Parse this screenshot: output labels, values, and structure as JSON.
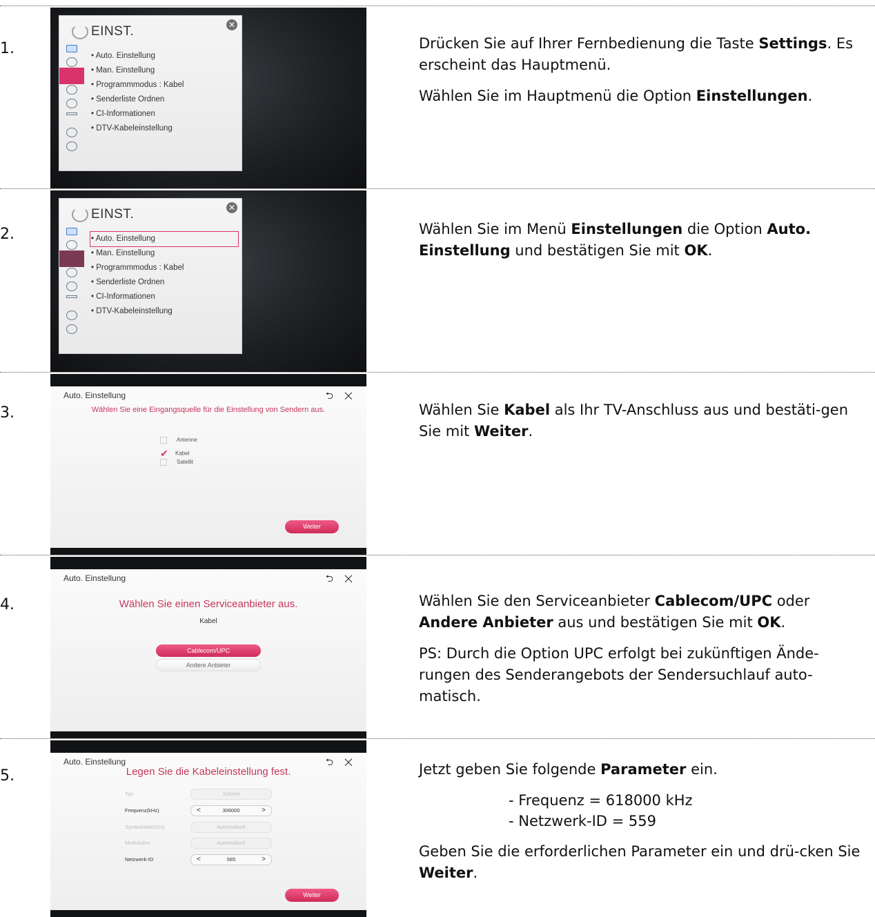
{
  "steps": [
    {
      "number": "1.",
      "paragraphs": [
        [
          [
            "Drücken Sie auf Ihrer Fernbedienung die Taste ",
            false
          ],
          [
            "Settings",
            true
          ],
          [
            ". Es erscheint das Hauptmenü.",
            false
          ]
        ],
        [
          [
            "Wählen Sie im Hauptmenü die Option ",
            false
          ],
          [
            "Einstellungen",
            true
          ],
          [
            ".",
            false
          ]
        ]
      ]
    },
    {
      "number": "2.",
      "paragraphs": [
        [
          [
            "Wählen Sie im Menü ",
            false
          ],
          [
            "Einstellungen",
            true
          ],
          [
            " die Option ",
            false
          ],
          [
            "Auto. Einstellung",
            true
          ],
          [
            " und bestätigen Sie mit ",
            false
          ],
          [
            "OK",
            true
          ],
          [
            ".",
            false
          ]
        ]
      ]
    },
    {
      "number": "3.",
      "paragraphs": [
        [
          [
            "Wählen Sie ",
            false
          ],
          [
            "Kabel",
            true
          ],
          [
            " als Ihr TV-Anschluss aus und bestäti-gen Sie mit ",
            false
          ],
          [
            "Weiter",
            true
          ],
          [
            ".",
            false
          ]
        ]
      ]
    },
    {
      "number": "4.",
      "paragraphs": [
        [
          [
            "Wählen Sie den Serviceanbieter ",
            false
          ],
          [
            "Cablecom/UPC",
            true
          ],
          [
            " oder ",
            false
          ],
          [
            "Andere Anbieter",
            true
          ],
          [
            " aus und bestätigen Sie mit ",
            false
          ],
          [
            "OK",
            true
          ],
          [
            ".",
            false
          ]
        ],
        [
          [
            "PS: Durch die Option UPC erfolgt bei zukünftigen Ände-rungen des Senderangebots der Sendersuchlauf auto-matisch.",
            false
          ]
        ]
      ]
    },
    {
      "number": "5.",
      "intro": [
        [
          "Jetzt geben Sie folgende ",
          false
        ],
        [
          "Parameter",
          true
        ],
        [
          " ein.",
          false
        ]
      ],
      "params": [
        "- Frequenz = 618000 kHz",
        "- Netzwerk-ID = 559"
      ],
      "outro": [
        [
          "Geben Sie die erforderlichen Parameter ein und drü-cken Sie ",
          false
        ],
        [
          "Weiter",
          true
        ],
        [
          ".",
          false
        ]
      ]
    }
  ],
  "menu": {
    "title": "EINST.",
    "close_icon": "close-icon",
    "items": [
      "• Auto. Einstellung",
      "• Man. Einstellung",
      "• Programmmodus      : Kabel",
      "• Senderliste Ordnen",
      "• CI-Informationen",
      "• DTV-Kabeleinstellung"
    ]
  },
  "dialog": {
    "title": "Auto. Einstellung",
    "controls": "⮌ ✕",
    "step3": {
      "subtitle": "Wählen Sie eine Eingangsquelle für die Einstellung von Sendern aus.",
      "options": [
        {
          "label": "Antenne",
          "checked": false
        },
        {
          "label": "Kabel",
          "checked": true
        },
        {
          "label": "Satellit",
          "checked": false
        }
      ],
      "next": "Weiter"
    },
    "step4": {
      "subtitle": "Wählen Sie einen Serviceanbieter aus.",
      "source": "Kabel",
      "option_selected": "Cablecom/UPC",
      "option_other": "Andere Anbieter"
    },
    "step5": {
      "subtitle": "Legen Sie die Kabeleinstellung fest.",
      "fields": [
        {
          "label": "Typ",
          "value": "Schnell",
          "enabled": false,
          "arrows": false
        },
        {
          "label": "Frequenz(kHz)",
          "value": "306000",
          "enabled": true,
          "arrows": true
        },
        {
          "label": "Symbolrate(kS/s)",
          "value": "Automatisch",
          "enabled": false,
          "arrows": false
        },
        {
          "label": "Modulation",
          "value": "Automatisch",
          "enabled": false,
          "arrows": false
        },
        {
          "label": "Netzwerk-ID",
          "value": "585",
          "enabled": true,
          "arrows": true
        }
      ],
      "next": "Weiter"
    }
  },
  "colors": {
    "accent": "#d9336b",
    "subtitle": "#c5365e",
    "separator": "#555555"
  }
}
